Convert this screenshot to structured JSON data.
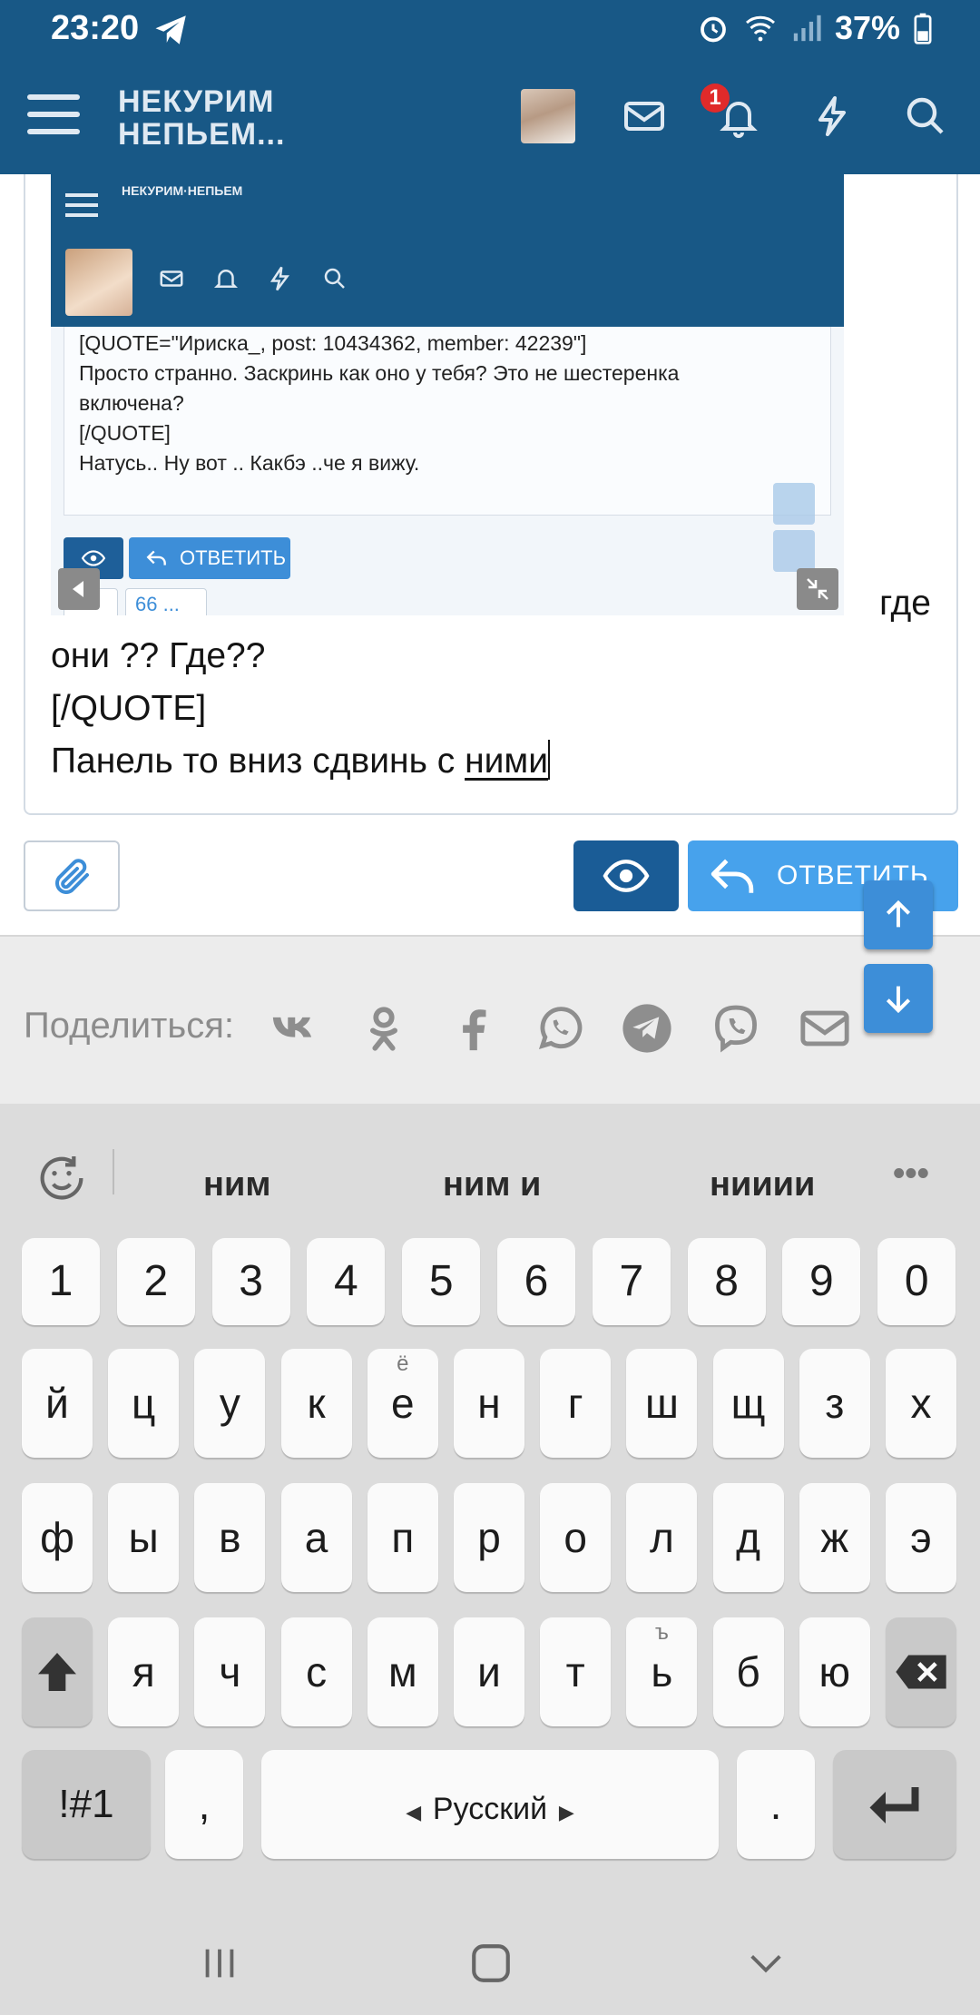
{
  "status_bar": {
    "time": "23:20",
    "battery": "37%"
  },
  "app_header": {
    "brand_line1": "НЕКУРИМ",
    "brand_line2": "НЕПЬЕМ...",
    "notification_count": "1"
  },
  "embedded_screenshot": {
    "brand": "НЕКУРИМ·НЕПЬЕМ",
    "quote_lines": [
      "[QUOTE=\"Ириска_, post: 10434362, member: 42239\"]",
      "Просто странно. Заскринь как оно у тебя? Это не шестеренка",
      "включена?",
      "[/QUOTE]",
      "Натусь.. Ну вот ..  Какбэ ..че я вижу."
    ],
    "reply_label": "ОТВЕТИТЬ",
    "quote_btn": "66 ..."
  },
  "editor": {
    "line0_tail": "где",
    "line1": "они ?? Где??",
    "line2": "[/QUOTE]",
    "line3_prefix": "Панель то вниз сдвинь с ",
    "line3_word": "ними"
  },
  "form": {
    "reply_label": "ОТВЕТИТЬ"
  },
  "share": {
    "label": "Поделиться:",
    "icons": [
      "vk-icon",
      "odnoklassniki-icon",
      "facebook-icon",
      "whatsapp-icon",
      "telegram-icon",
      "viber-icon",
      "email-icon"
    ]
  },
  "keyboard": {
    "suggestions": [
      "ним",
      "ним и",
      "нииии"
    ],
    "row_numbers": [
      "1",
      "2",
      "3",
      "4",
      "5",
      "6",
      "7",
      "8",
      "9",
      "0"
    ],
    "row1": [
      "й",
      "ц",
      "у",
      "к",
      "е",
      "н",
      "г",
      "ш",
      "щ",
      "з",
      "х"
    ],
    "row1_sub": {
      "4": "ё"
    },
    "row2": [
      "ф",
      "ы",
      "в",
      "а",
      "п",
      "р",
      "о",
      "л",
      "д",
      "ж",
      "э"
    ],
    "row3": [
      "я",
      "ч",
      "с",
      "м",
      "и",
      "т",
      "ь",
      "б",
      "ю"
    ],
    "row3_sub": {
      "6": "ъ"
    },
    "symbols_key": "!#1",
    "comma_key": ",",
    "space_label": "Русский",
    "period_key": "."
  },
  "colors": {
    "header": "#185886",
    "reply_button": "#47a2ec",
    "preview_button": "#1a5c96",
    "badge": "#e02a2a"
  }
}
